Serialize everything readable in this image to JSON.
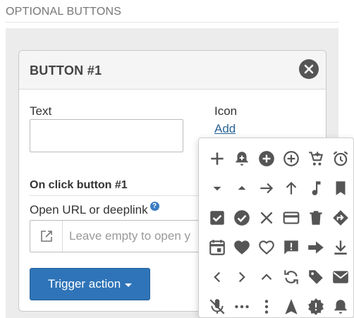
{
  "section": {
    "title": "OPTIONAL BUTTONS"
  },
  "card": {
    "title": "BUTTON #1",
    "text_label": "Text",
    "text_value": "",
    "icon_label": "Icon",
    "add_link": "Add",
    "on_click_heading": "On click button #1",
    "url_label": "Open URL or deeplink",
    "url_placeholder": "Leave empty to open y",
    "trigger_label": "Trigger action"
  },
  "icon_picker": {
    "icons": [
      "plus-icon",
      "notification-add-icon",
      "add-circle-icon",
      "add-circle-outline-icon",
      "add-shopping-cart-icon",
      "alarm-icon",
      "arrow-drop-down-icon",
      "arrow-drop-up-icon",
      "arrow-forward-icon",
      "arrow-upward-icon",
      "music-note-icon",
      "bookmark-icon",
      "check-box-icon",
      "check-circle-icon",
      "close-icon",
      "credit-card-icon",
      "delete-icon",
      "directions-icon",
      "event-icon",
      "favorite-icon",
      "favorite-border-icon",
      "feedback-icon",
      "forward-arrow-icon",
      "file-download-icon",
      "chevron-left-icon",
      "chevron-right-icon",
      "chevron-up-icon",
      "sync-icon",
      "local-offer-icon",
      "mail-icon",
      "mic-off-icon",
      "more-horiz-icon",
      "more-vert-icon",
      "navigation-icon",
      "new-releases-icon",
      "notifications-icon"
    ]
  },
  "colors": {
    "accent": "#2f74b8",
    "icon": "#555555",
    "panel_bg": "#ececec"
  }
}
